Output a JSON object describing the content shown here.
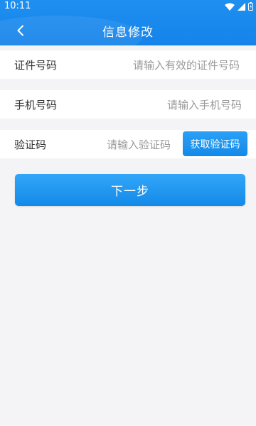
{
  "status_bar": {
    "time": "10:11",
    "icons": [
      "wifi-icon",
      "cellular-signal-icon",
      "battery-icon"
    ]
  },
  "header": {
    "title": "信息修改",
    "back_icon": "chevron-left-icon",
    "color": "#1a88ee"
  },
  "form": {
    "id_number": {
      "label": "证件号码",
      "placeholder": "请输入有效的证件号码"
    },
    "phone": {
      "label": "手机号码",
      "placeholder": "请输入手机号码"
    },
    "verification": {
      "label": "验证码",
      "placeholder": "请输入验证码",
      "get_code_label": "获取验证码"
    }
  },
  "next_button": {
    "label": "下一步",
    "color": "#1a8fec"
  }
}
